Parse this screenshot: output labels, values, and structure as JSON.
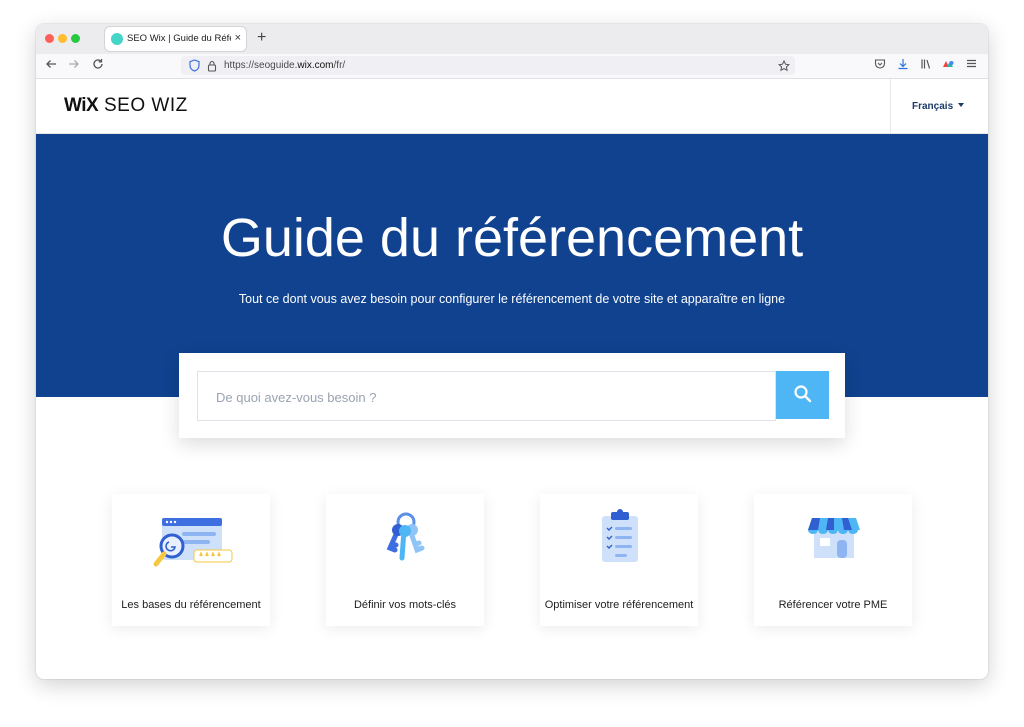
{
  "browser": {
    "tab_title": "SEO Wix | Guide du Référencement",
    "tab_close": "×",
    "new_tab": "+",
    "url_prefix": "https://seoguide.",
    "url_domain": "wix.com",
    "url_suffix": "/fr/",
    "icons": [
      "back-arrow-icon",
      "forward-arrow-icon",
      "reload-icon",
      "shield-icon",
      "lock-icon",
      "star-icon",
      "pocket-icon",
      "download-icon",
      "library-icon",
      "extension-icon",
      "menu-icon"
    ]
  },
  "header": {
    "logo_wix": "WiX",
    "logo_text": "SEO WIZ",
    "language": "Français"
  },
  "hero": {
    "title": "Guide du référencement",
    "subtitle": "Tout ce dont vous avez besoin pour configurer le référencement de votre site et apparaître en ligne"
  },
  "search": {
    "placeholder": "De quoi avez-vous besoin ?",
    "button_icon": "search-icon"
  },
  "cards": [
    {
      "label": "Les bases du référencement",
      "icon": "seo-basics-icon"
    },
    {
      "label": "Définir vos mots-clés",
      "icon": "keys-icon"
    },
    {
      "label": "Optimiser votre référencement",
      "icon": "clipboard-checklist-icon"
    },
    {
      "label": "Référencer votre PME",
      "icon": "storefront-icon"
    }
  ],
  "colors": {
    "hero_bg": "#10428f",
    "search_button": "#4eb6f4",
    "language_text": "#1b3a68"
  }
}
